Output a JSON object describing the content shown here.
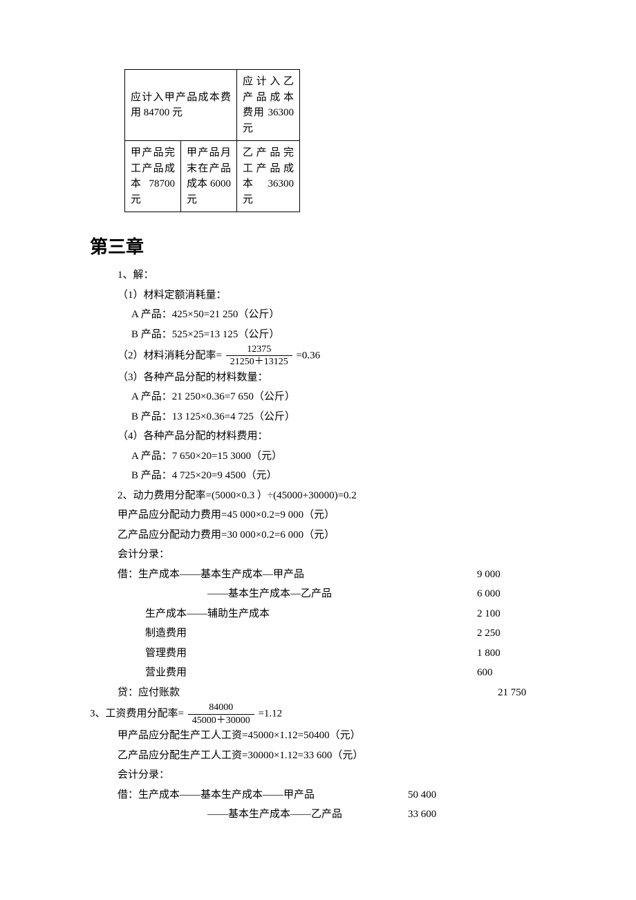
{
  "table": {
    "r1c12": "应计入甲产品成本费用 84700 元",
    "r1c3": "应计入乙产品成本费用 36300 元",
    "r2c1": "甲产品完工产品成本 78700 元",
    "r2c2": "甲产品月末在产品成本 6000 元",
    "r2c3": "乙产品完工产品成本 36300 元"
  },
  "chapter": "第三章",
  "q1": {
    "head": "1、解：",
    "p1": "（1）材料定额消耗量：",
    "p1a": "A 产品：425×50=21 250（公斤）",
    "p1b": "B 产品：525×25=13 125（公斤）",
    "p2_pre": "（2）材料消耗分配率=",
    "p2_num": "12375",
    "p2_den": "21250＋13125",
    "p2_post": "=0.36",
    "p3": "（3）各种产品分配的材料数量：",
    "p3a": "A 产品：21 250×0.36=7 650（公斤）",
    "p3b": "B 产品：13 125×0.36=4 725（公斤）",
    "p4": "（4）各种产品分配的材料费用：",
    "p4a": "A 产品：7 650×20=15 3000（元）",
    "p4b": "B 产品：4 725×20=9 4500（元）"
  },
  "q2": {
    "l1": "2、动力费用分配率=(5000×0.3 ）÷(45000+30000)=0.2",
    "l2": "甲产品应分配动力费用=45 000×0.2=9 000（元）",
    "l3": "乙产品应分配动力费用=30 000×0.2=6 000（元）",
    "l4": "会计分录：",
    "l5_label": "借：生产成本——基本生产成本—甲产品",
    "l5_amt": "9 000",
    "l6_label": "——基本生产成本—乙产品",
    "l6_amt": "6 000",
    "l7_label": "生产成本——辅助生产成本",
    "l7_amt": "2 100",
    "l8_label": "制造费用",
    "l8_amt": "2 250",
    "l9_label": "管理费用",
    "l9_amt": "1 800",
    "l10_label": "营业费用",
    "l10_amt": "600",
    "l11_label": "贷：应付账款",
    "l11_amt": "21 750"
  },
  "q3": {
    "head_pre": "3、工资费用分配率=",
    "num": "84000",
    "den": "45000＋30000",
    "head_post": "=1.12",
    "l2": "甲产品应分配生产工人工资=45000×1.12=50400（元）",
    "l3": "乙产品应分配生产工人工资=30000×1.12=33 600（元）",
    "l4": "会计分录：",
    "l5_label": "借：生产成本——基本生产成本——甲产品",
    "l5_amt": "50 400",
    "l6_label": "——基本生产成本——乙产品",
    "l6_amt": "33 600"
  }
}
